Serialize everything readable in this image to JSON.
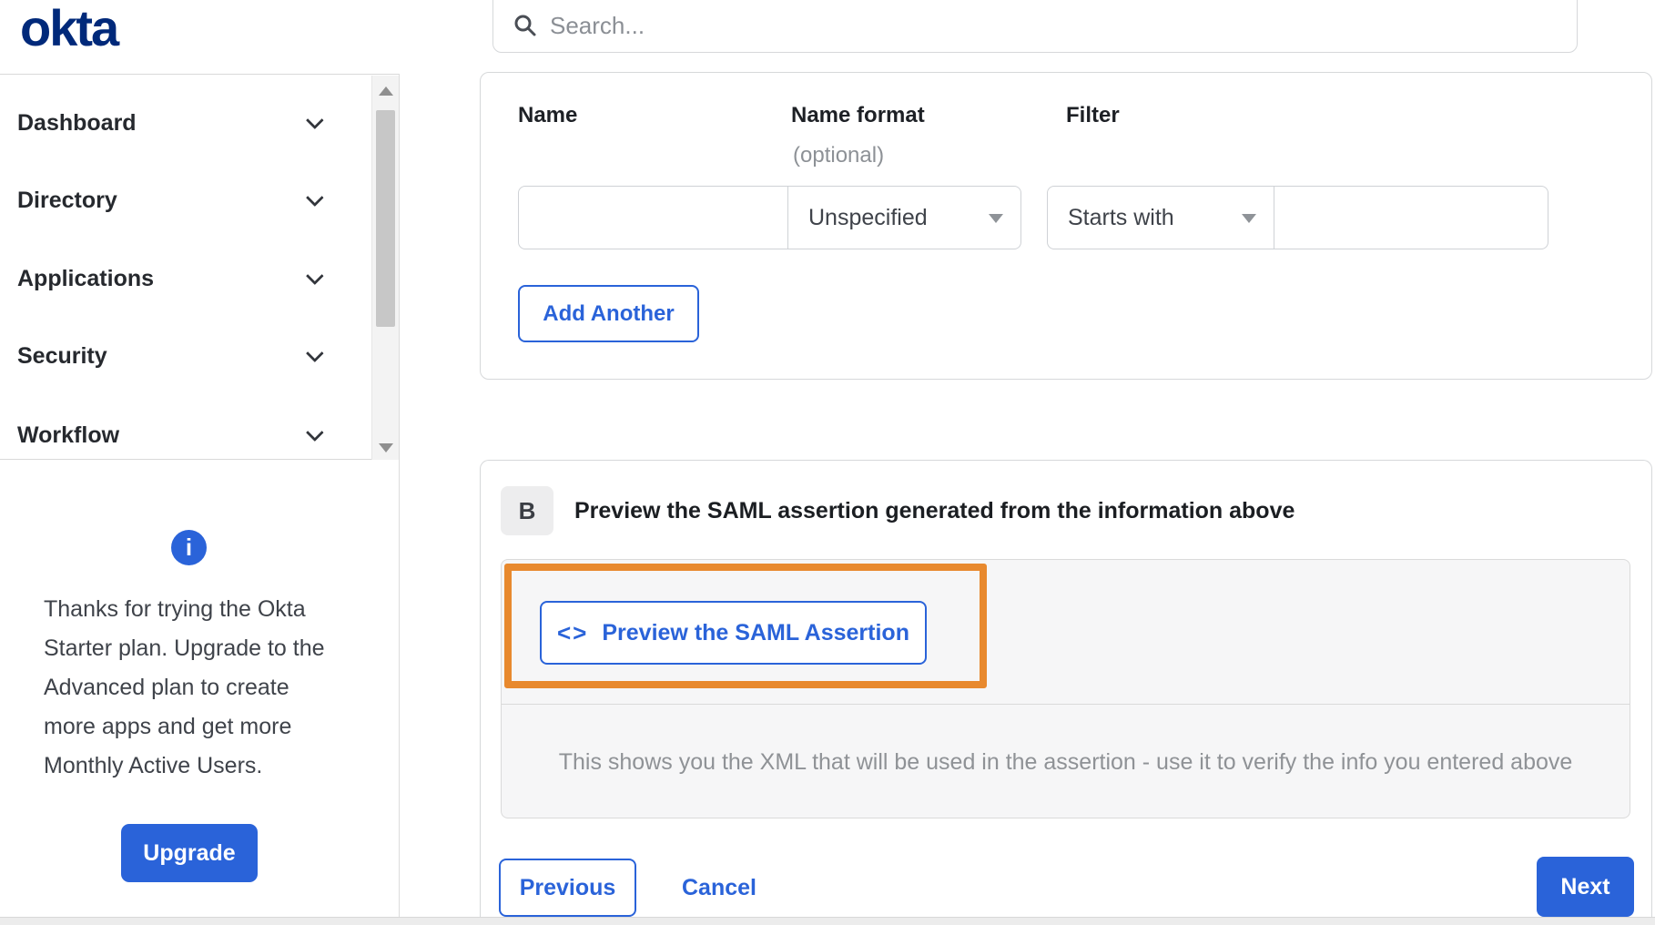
{
  "brand": {
    "logo": "okta"
  },
  "header": {
    "search_placeholder": "Search..."
  },
  "sidebar": {
    "items": [
      {
        "label": "Dashboard"
      },
      {
        "label": "Directory"
      },
      {
        "label": "Applications"
      },
      {
        "label": "Security"
      },
      {
        "label": "Workflow"
      }
    ],
    "trial_message": "Thanks for trying the Okta Starter plan. Upgrade to the Advanced plan to create more apps and get more Monthly Active Users.",
    "upgrade_label": "Upgrade"
  },
  "attributes_card": {
    "name_label": "Name",
    "name_format_label": "Name format",
    "name_format_hint": "(optional)",
    "filter_label": "Filter",
    "name_value": "",
    "name_format_value": "Unspecified",
    "filter_operator_value": "Starts with",
    "filter_value": "",
    "add_another_label": "Add Another"
  },
  "preview_section": {
    "badge": "B",
    "title": "Preview the SAML assertion generated from the information above",
    "preview_button_icon": "<>",
    "preview_button_label": "Preview the SAML Assertion",
    "description": "This shows you the XML that will be used in the assertion - use it to verify the info you entered above"
  },
  "footer": {
    "previous_label": "Previous",
    "cancel_label": "Cancel",
    "next_label": "Next"
  },
  "icons": {
    "info": "i"
  },
  "colors": {
    "accent_blue": "#2a63d9",
    "logo_navy": "#00297a",
    "highlight_orange": "#e8892e"
  }
}
